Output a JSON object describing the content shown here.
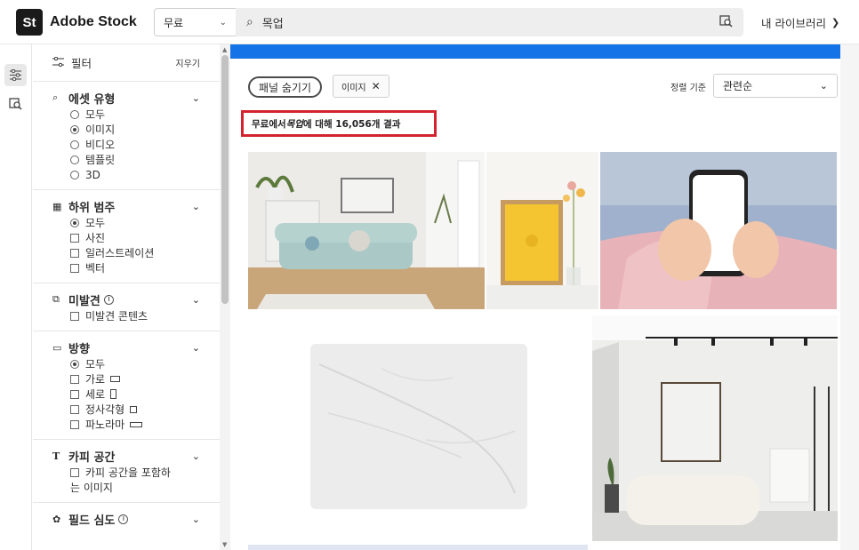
{
  "header": {
    "logo_mark": "St",
    "logo_text": "Adobe Stock",
    "scope_value": "무료",
    "search_value": "목업",
    "library_label": "내 라이브러리"
  },
  "filters": {
    "title": "필터",
    "clear_label": "지우기",
    "asset_type": {
      "title": "에셋 유형",
      "options": [
        "모두",
        "이미지",
        "비디오",
        "템플릿",
        "3D"
      ],
      "selected": "이미지"
    },
    "subcategory": {
      "title": "하위 범주",
      "options": [
        "모두",
        "사진",
        "일러스트레이션",
        "벡터"
      ]
    },
    "undiscovered": {
      "title": "미발견",
      "option": "미발견 콘텐츠"
    },
    "orientation": {
      "title": "방향",
      "options": [
        "모두",
        "가로",
        "세로",
        "정사각형",
        "파노라마"
      ]
    },
    "copy_space": {
      "title": "카피 공간",
      "option_line1": "카피 공간을 포함하",
      "option_line2": "는 이미지"
    },
    "depth_of_field": {
      "title": "필드 심도"
    }
  },
  "toolbar": {
    "hide_panel_label": "패널 숨기기",
    "active_tag": "이미지",
    "sort_label": "정렬 기준",
    "sort_value": "관련순"
  },
  "results": {
    "prefix": "무료에서 ",
    "query": "목업",
    "suffix": "에 대해 16,056개 결과"
  },
  "colors": {
    "accent_blue": "#1473e6",
    "highlight_red": "#d4232e"
  }
}
